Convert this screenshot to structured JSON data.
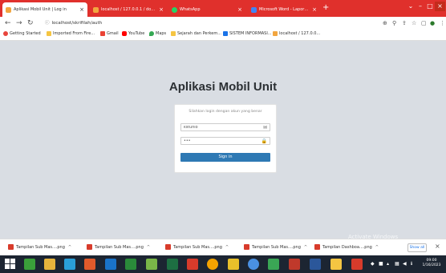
{
  "browser": {
    "tabs": [
      {
        "label": "Aplikasi Mobil Unit | Log in",
        "active": true,
        "color": "#f2a640"
      },
      {
        "label": "localhost / 127.0.0.1 / donordarah",
        "active": false,
        "color": "#f2a640"
      },
      {
        "label": "WhatsApp",
        "active": false,
        "color": "#25d366"
      },
      {
        "label": "Microsoft Word - Laporan TA Fu...",
        "active": false,
        "color": "#4285f4"
      }
    ],
    "url": "localhost/skrifilah/auth",
    "bookmarks": [
      {
        "label": "Getting Started",
        "color": "#e8453c"
      },
      {
        "label": "Imported From Fire...",
        "color": "#f5c542"
      },
      {
        "label": "Gmail",
        "color": "#ea4335"
      },
      {
        "label": "YouTube",
        "color": "#ff0000"
      },
      {
        "label": "Maps",
        "color": "#34a853"
      },
      {
        "label": "Sejarah dan Perkem...",
        "color": "#f5c542"
      },
      {
        "label": "SISTEM INFORMASI...",
        "color": "#1a73e8"
      },
      {
        "label": "localhost / 127.0.0...",
        "color": "#f2a640"
      }
    ]
  },
  "login": {
    "title": "Aplikasi Mobil Unit",
    "hint": "Silahkan login dengan akun yang benar",
    "username_value": "kstunio",
    "password_value": "•••",
    "signin_label": "Sign in"
  },
  "watermark": {
    "line1": "Activate Windows",
    "line2": "Go to PC settings to activate Windows."
  },
  "downloads": {
    "items": [
      {
        "label": "Tampilan Sub Mas....png"
      },
      {
        "label": "Tampilan Sub Mas....png"
      },
      {
        "label": "Tampilan Sub Mas....png"
      },
      {
        "label": "Tampilan Sub Mas....png"
      },
      {
        "label": "Tampilan Dashboa....png"
      }
    ],
    "show_all": "Show all"
  },
  "taskbar": {
    "time": "09:00",
    "date": "1/16/2023"
  }
}
